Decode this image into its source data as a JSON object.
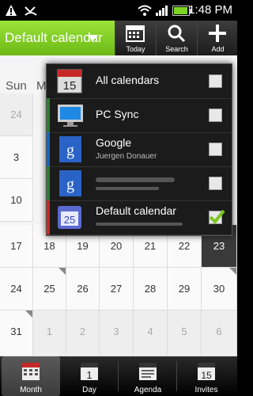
{
  "status": {
    "time": "1:48 PM"
  },
  "actionbar": {
    "calendar_label": "Default calendar",
    "today_label": "Today",
    "search_label": "Search",
    "add_label": "Add"
  },
  "calendar": {
    "weekday_headers": [
      "Sun",
      "M"
    ],
    "weeks": [
      [
        "24",
        "",
        "",
        "",
        "",
        "",
        ""
      ],
      [
        "3",
        "",
        "",
        "",
        "",
        "",
        ""
      ],
      [
        "10",
        "",
        "",
        "",
        "",
        "",
        ""
      ],
      [
        "17",
        "18",
        "19",
        "20",
        "21",
        "22",
        "23"
      ],
      [
        "24",
        "25",
        "26",
        "27",
        "28",
        "29",
        "30"
      ],
      [
        "31",
        "1",
        "2",
        "3",
        "4",
        "5",
        "6"
      ]
    ]
  },
  "popup": {
    "items": [
      {
        "title": "All calendars",
        "sub": "",
        "color": "#1b1b1b",
        "checked": false
      },
      {
        "title": "PC Sync",
        "sub": "",
        "color": "#2e7d32",
        "checked": false
      },
      {
        "title": "Google",
        "sub": "Juergen Donauer",
        "color": "#1565c0",
        "checked": false
      },
      {
        "title": "",
        "sub": "",
        "color": "#2e7d32",
        "checked": false
      },
      {
        "title": "Default calendar",
        "sub": "",
        "color": "#c62828",
        "checked": true
      }
    ]
  },
  "bottomnav": {
    "tabs": [
      {
        "label": "Month",
        "active": true
      },
      {
        "label": "Day",
        "active": false
      },
      {
        "label": "Agenda",
        "active": false
      },
      {
        "label": "Invites",
        "active": false
      }
    ]
  },
  "icons": {
    "calendar_day": "1",
    "invites_day": "15",
    "default_calendar_day": "25",
    "all_calendars_day": "15"
  }
}
